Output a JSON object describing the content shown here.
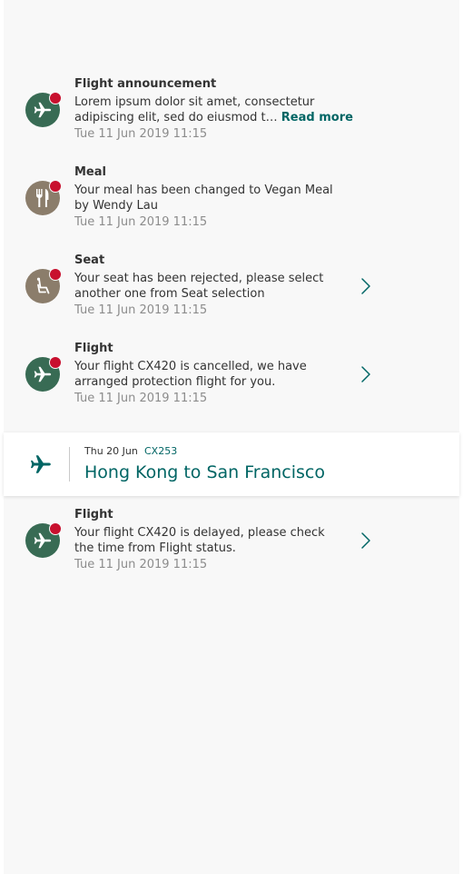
{
  "colors": {
    "brand_green": "#386b54",
    "meal_brown": "#8b7d6b",
    "accent_teal": "#006564",
    "unread_red": "#c8102e",
    "time_gray": "#8c8c8c"
  },
  "notifications": [
    {
      "title": "Flight announcement",
      "body": "Lorem ipsum dolor sit amet, consectetur adipiscing elit, sed do eiusmod t…",
      "read_more": "Read more",
      "time": "Tue 11 Jun 2019 11:15",
      "icon": "airplane-icon",
      "unread": true
    },
    {
      "title": "Meal",
      "body": "Your meal has been changed to Vegan Meal by Wendy Lau",
      "time": "Tue 11 Jun 2019 11:15",
      "icon": "fork-knife-icon",
      "unread": true
    },
    {
      "title": "Seat",
      "body": "Your seat has been rejected, please select another one from Seat selection",
      "time": "Tue 11 Jun 2019 11:15",
      "icon": "seat-icon",
      "unread": true
    },
    {
      "title": "Flight",
      "body": "Your flight CX420 is cancelled, we have arranged protection flight for you.",
      "time": "Tue 11 Jun 2019 11:15",
      "icon": "airplane-icon",
      "unread": true
    }
  ],
  "trip": {
    "date": "Thu 20 Jun",
    "flight": "CX253",
    "route": "Hong Kong to San Francisco",
    "icon": "airplane-icon"
  },
  "trip_notifications": [
    {
      "title": "Flight",
      "body": "Your flight CX420 is delayed, please check the time from Flight status.",
      "time": "Tue 11 Jun 2019 11:15",
      "icon": "airplane-icon",
      "unread": true
    }
  ]
}
